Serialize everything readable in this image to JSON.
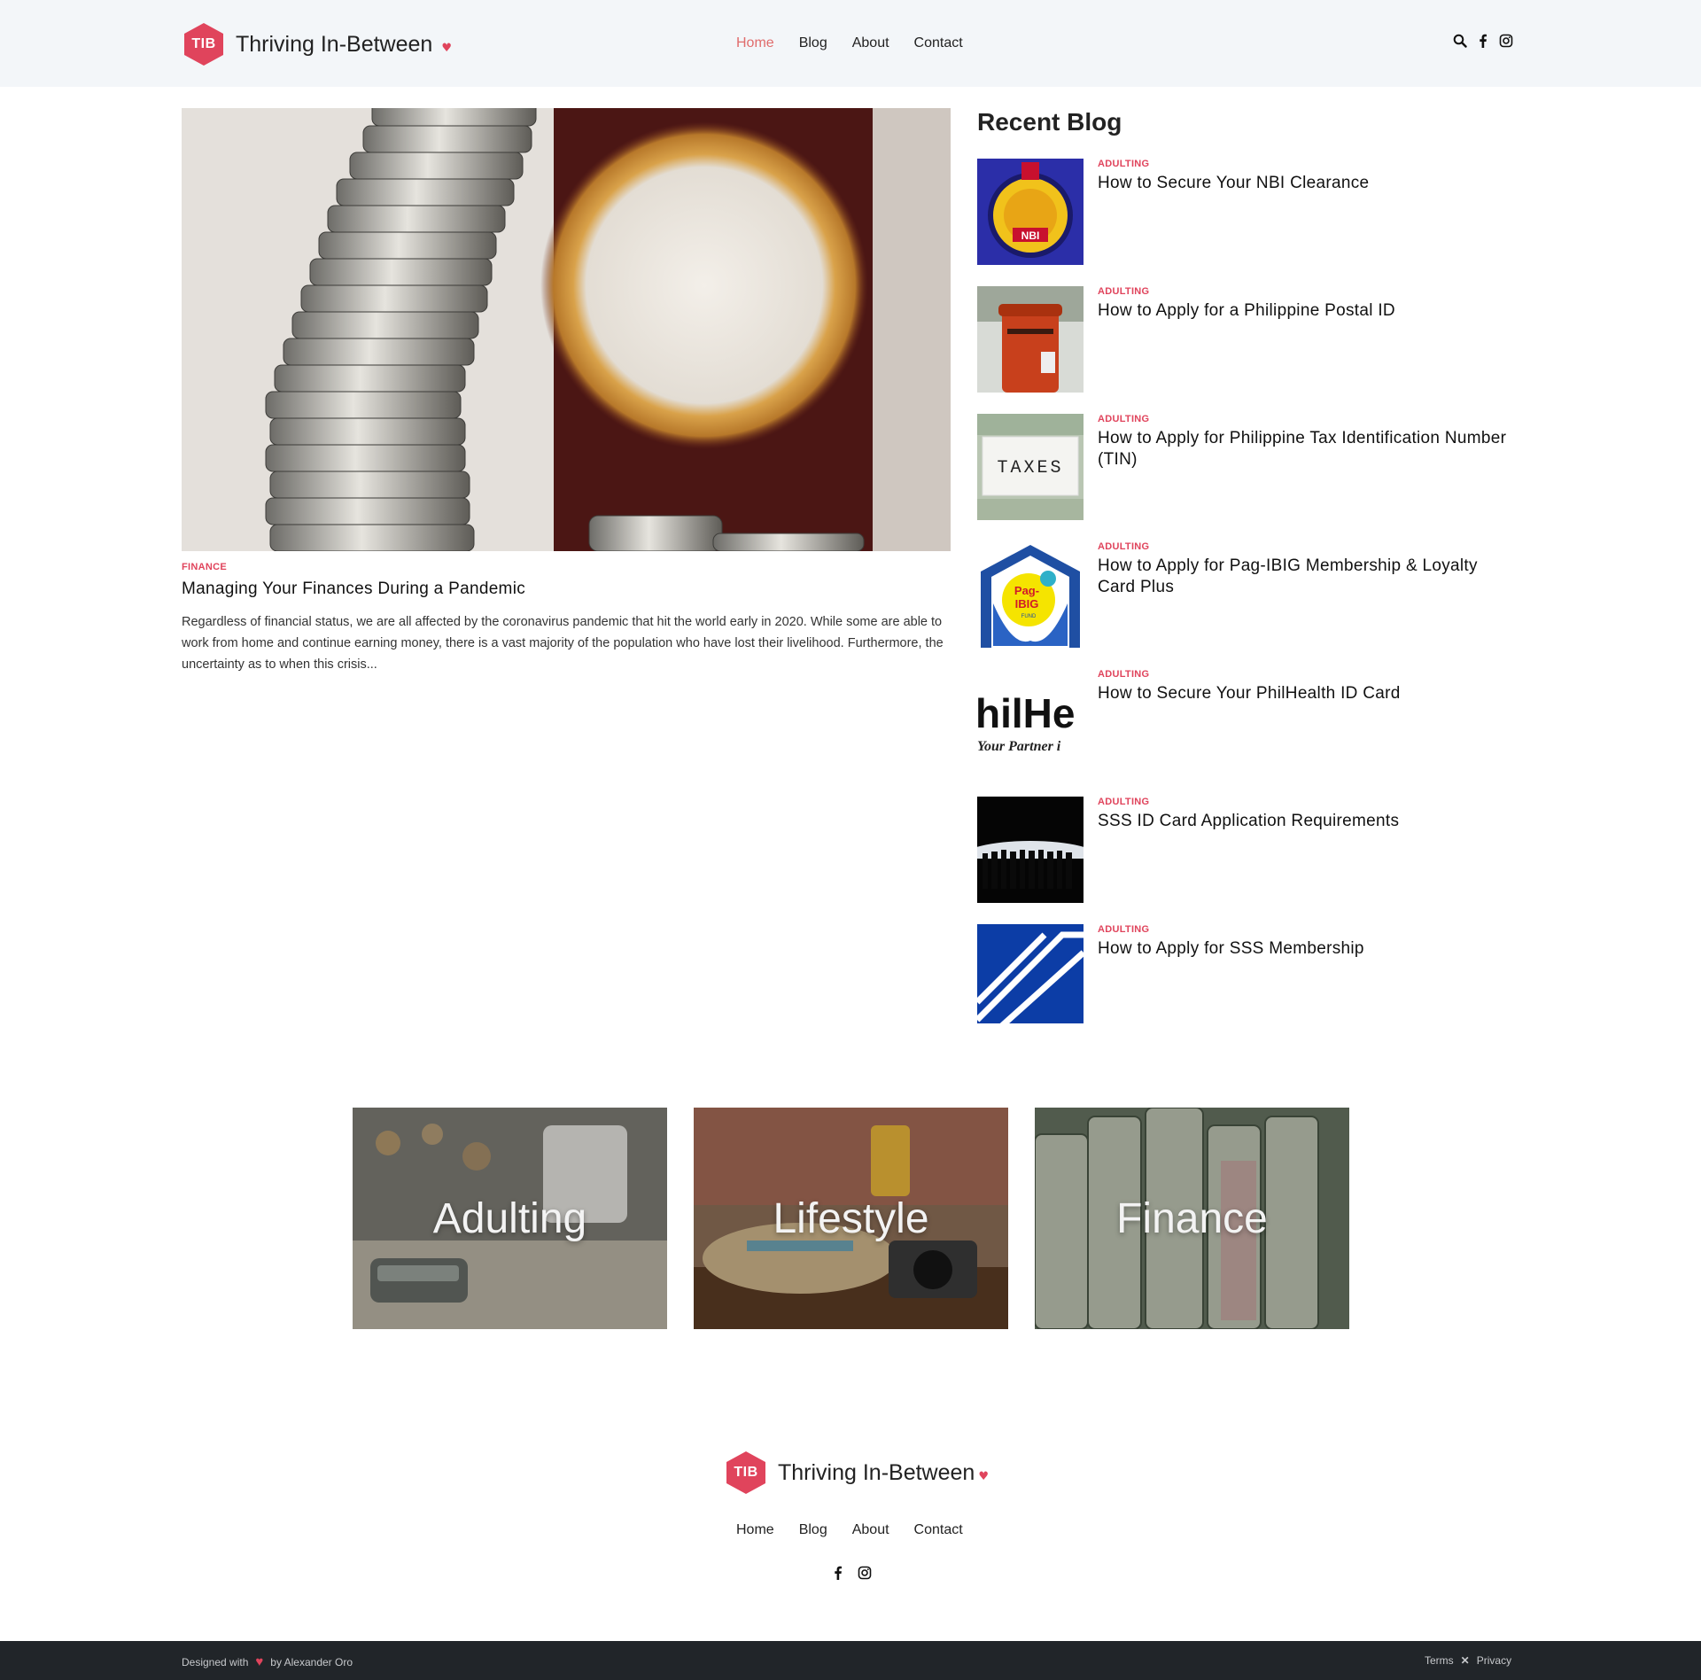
{
  "header": {
    "logo_abbr": "TIB",
    "brand": "Thriving In-Between",
    "nav": [
      "Home",
      "Blog",
      "About",
      "Contact"
    ],
    "active_nav": "Home",
    "icons": [
      "search-icon",
      "facebook-icon",
      "instagram-icon"
    ]
  },
  "featured": {
    "category": "FINANCE",
    "title": "Managing Your Finances During a Pandemic",
    "excerpt": "Regardless of financial status, we are all affected by the coronavirus pandemic that hit the world early in 2020. While some are able to work from home and continue earning money, there is a vast majority of the population who have lost their livelihood. Furthermore, the uncertainty as to when this crisis..."
  },
  "sidebar": {
    "title": "Recent Blog",
    "posts": [
      {
        "category": "ADULTING",
        "title": "How to Secure Your NBI Clearance"
      },
      {
        "category": "ADULTING",
        "title": "How to Apply for a Philippine Postal ID"
      },
      {
        "category": "ADULTING",
        "title": "How to Apply for Philippine Tax Identification Number (TIN)"
      },
      {
        "category": "ADULTING",
        "title": "How to Apply for Pag-IBIG Membership & Loyalty Card Plus"
      },
      {
        "category": "ADULTING",
        "title": "How to Secure Your PhilHealth ID Card"
      },
      {
        "category": "ADULTING",
        "title": "SSS ID Card Application Requirements"
      },
      {
        "category": "ADULTING",
        "title": "How to Apply for SSS Membership"
      }
    ],
    "thumb_text": {
      "nbi": "NBI",
      "taxes": "TAXES",
      "pagibig_1": "Pag-",
      "pagibig_2": "IBIG",
      "pagibig_3": "FUND",
      "philhealth_1": "hilHe",
      "philhealth_2": "Your Partner i"
    }
  },
  "categories": [
    "Adulting",
    "Lifestyle",
    "Finance"
  ],
  "footer": {
    "logo_abbr": "TIB",
    "brand": "Thriving In-Between",
    "nav": [
      "Home",
      "Blog",
      "About",
      "Contact"
    ],
    "icons": [
      "facebook-icon",
      "instagram-icon"
    ]
  },
  "bottom_bar": {
    "designed_with": "Designed with",
    "by": "by Alexander Oro",
    "terms": "Terms",
    "privacy": "Privacy"
  },
  "colors": {
    "accent": "#e0445c",
    "header_bg": "#f3f6f9",
    "footer_bar_bg": "#212529"
  }
}
